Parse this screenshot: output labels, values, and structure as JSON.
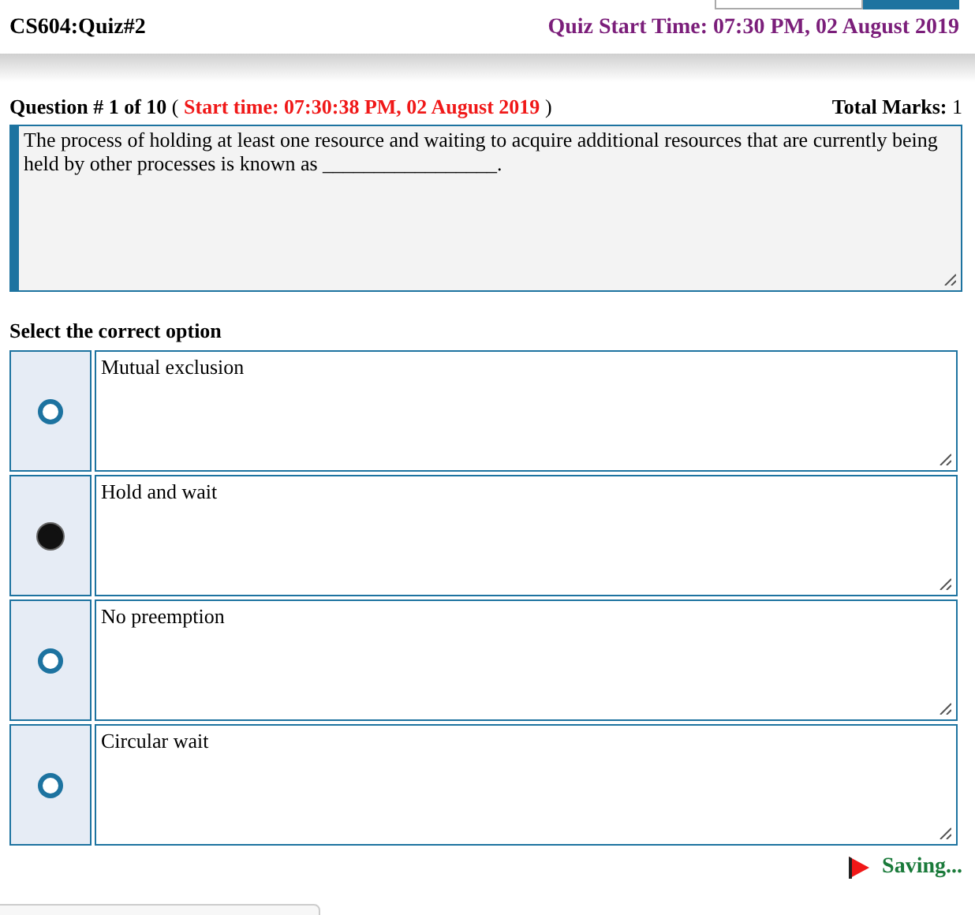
{
  "header": {
    "quiz_title": "CS604:Quiz#2",
    "start_time": "Quiz Start Time: 07:30 PM, 02 August 2019"
  },
  "question": {
    "number": "Question # 1 of 10",
    "open_paren": "(",
    "start_time": "Start time: 07:30:38 PM, 02 August 2019",
    "close_paren": ")",
    "marks_label": "Total Marks:",
    "marks": "1",
    "text": "The process of holding at least one resource and waiting to acquire additional resources that are currently being held by other processes is known as _________________."
  },
  "options_heading": "Select the correct option",
  "options": [
    {
      "text": "Mutual exclusion",
      "selected": false
    },
    {
      "text": "Hold and wait",
      "selected": true
    },
    {
      "text": "No preemption",
      "selected": false
    },
    {
      "text": "Circular wait",
      "selected": false
    }
  ],
  "status": "Saving..."
}
